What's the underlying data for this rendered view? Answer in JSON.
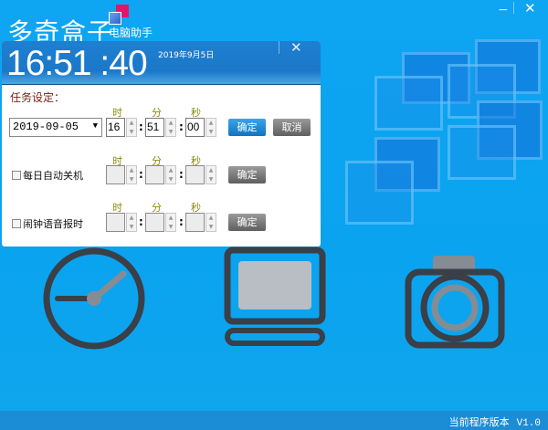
{
  "app": {
    "title": "多奇盒子",
    "subtitle": "电脑助手",
    "minimize": "−",
    "close": "✕"
  },
  "panel": {
    "time": "16:51 :40",
    "date": "2019年9月5日",
    "close": "✕",
    "task_label": "任务设定：",
    "units": {
      "hour": "时",
      "minute": "分",
      "second": "秒"
    },
    "task": {
      "date": "2019-09-05",
      "hour": "16",
      "minute": "51",
      "second": "00",
      "ok": "确定",
      "cancel": "取消"
    },
    "shutdown": {
      "label": "每日自动关机",
      "checked": false,
      "ok": "确定"
    },
    "alarm": {
      "label": "闹钟语音报时",
      "checked": false,
      "ok": "确定"
    }
  },
  "icons": [
    "clock-icon",
    "monitor-icon",
    "camera-icon"
  ],
  "footer": {
    "version_label": "当前程序版本",
    "version": "V1.0"
  },
  "colors": {
    "background": "#0ea5f2",
    "footer": "#1b8cd6",
    "icon_dark": "#3a3f48",
    "icon_gray": "#868c94"
  }
}
